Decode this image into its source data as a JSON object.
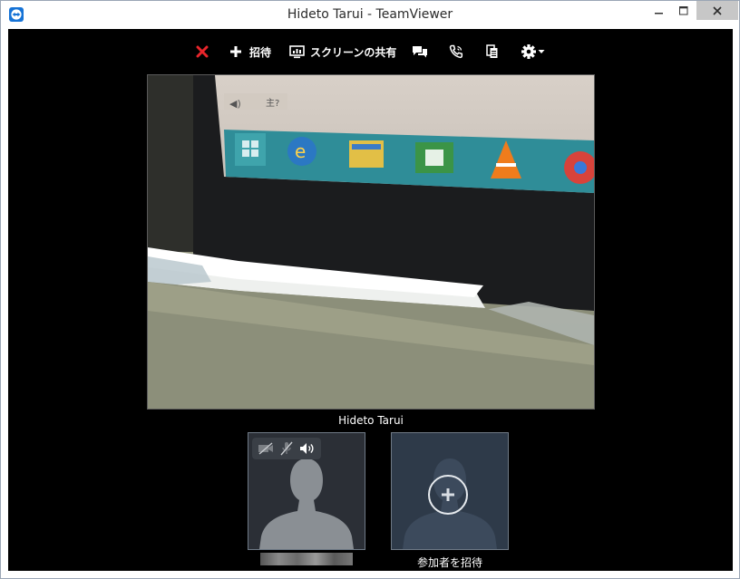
{
  "window": {
    "title": "Hideto Tarui - TeamViewer"
  },
  "toolbar": {
    "invite_label": "招待",
    "share_screen_label": "スクリーンの共有",
    "icons": [
      "close-session-icon",
      "plus-icon",
      "monitor-icon",
      "chat-icon",
      "phone-icon",
      "files-icon",
      "gear-icon"
    ]
  },
  "video": {
    "participant_name": "Hideto Tarui"
  },
  "self_tile": {
    "icons": [
      "video-off-icon",
      "mic-off-icon",
      "speaker-icon"
    ]
  },
  "invite_tile": {
    "label": "参加者を招待"
  },
  "colors": {
    "background": "#000000",
    "close_red": "#e8252b",
    "tile_self": "#2b2f36",
    "tile_invite": "#2e3a49"
  }
}
